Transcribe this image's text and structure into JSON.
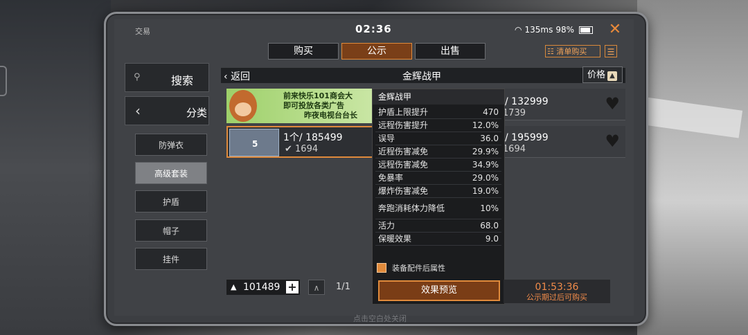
{
  "status": {
    "app_label": "交易",
    "time": "02:36",
    "network": "135ms",
    "battery": "98%"
  },
  "tabs": [
    {
      "label": "购买",
      "active": false
    },
    {
      "label": "公示",
      "active": true
    },
    {
      "label": "出售",
      "active": false
    }
  ],
  "toolbar": {
    "list_buy": "清单购买"
  },
  "sidebar": {
    "search": "搜索",
    "category": "分类",
    "items": [
      "防弹衣",
      "高级套装",
      "护盾",
      "帽子",
      "挂件"
    ],
    "selected_index": 1
  },
  "panel": {
    "back": "返回",
    "title": "金辉战甲",
    "sort": "价格"
  },
  "ad": {
    "line1": "前来快乐101商会大",
    "line2": "即可投放各类广告",
    "line3": "昨夜电视台台长"
  },
  "listings": [
    {
      "level": "5",
      "qty_price": "1个/ 185499",
      "count": "1694"
    },
    {
      "qty_price": "个/ 132999",
      "count": "1739"
    },
    {
      "qty_price": "个/ 195999",
      "count": "1694"
    }
  ],
  "tooltip": {
    "title": "金辉战甲",
    "stats": [
      {
        "name": "护盾上限提升",
        "value": "470"
      },
      {
        "name": "远程伤害提升",
        "value": "12.0%"
      },
      {
        "name": "误导",
        "value": "36.0"
      },
      {
        "name": "近程伤害减免",
        "value": "29.9%"
      },
      {
        "name": "远程伤害减免",
        "value": "34.9%"
      },
      {
        "name": "免暴率",
        "value": "29.0%"
      },
      {
        "name": "爆炸伤害减免",
        "value": "19.0%"
      },
      {
        "name": "奔跑消耗体力降低",
        "value": "10%"
      },
      {
        "name": "活力",
        "value": "68.0"
      },
      {
        "name": "保暖效果",
        "value": "9.0"
      }
    ],
    "checkbox_label": "装备配件后属性",
    "preview_button": "效果预览"
  },
  "bottom": {
    "currency": "101489",
    "page": "1/1",
    "timer": "01:53:36",
    "timer_note": "公示期过后可购买",
    "close_hint": "点击空白处关闭"
  },
  "colors": {
    "accent": "#e08a3b",
    "timer": "#f08b4a"
  }
}
